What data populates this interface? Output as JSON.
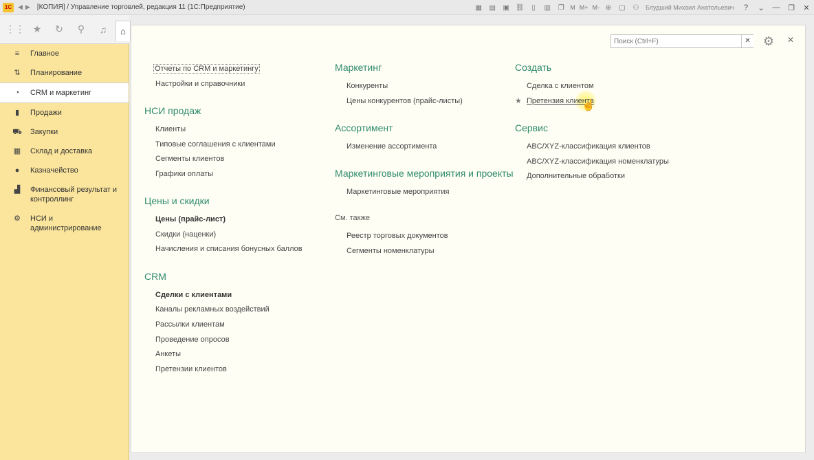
{
  "app": {
    "title": "[КОПИЯ] / Управление торговлей, редакция 11  (1С:Предприятие)",
    "logo": "1С",
    "user": "Блудший Михаил Анатольевич",
    "toolbar_labels": [
      "M",
      "M+",
      "M-"
    ]
  },
  "sidebar": {
    "items": [
      {
        "label": "Главное",
        "icon": "menu-icon",
        "glyph": "≡",
        "active": false
      },
      {
        "label": "Планирование",
        "icon": "planning-icon",
        "glyph": "⇅",
        "active": false
      },
      {
        "label": "CRM и маркетинг",
        "icon": "pie-chart-icon",
        "glyph": "◔",
        "active": true
      },
      {
        "label": "Продажи",
        "icon": "bag-icon",
        "glyph": "▮",
        "active": false
      },
      {
        "label": "Закупки",
        "icon": "cart-icon",
        "glyph": "⛟",
        "active": false
      },
      {
        "label": "Склад и доставка",
        "icon": "warehouse-icon",
        "glyph": "▦",
        "active": false
      },
      {
        "label": "Казначейство",
        "icon": "coin-icon",
        "glyph": "●",
        "active": false
      },
      {
        "label": "Финансовый результат и контроллинг",
        "icon": "bar-chart-icon",
        "glyph": "▟",
        "active": false
      },
      {
        "label": "НСИ и администрирование",
        "icon": "gear-icon",
        "glyph": "⚙",
        "active": false
      }
    ]
  },
  "search": {
    "placeholder": "Поиск (Ctrl+F)"
  },
  "col1": {
    "top_links": [
      "Отчеты по CRM и маркетингу",
      "Настройки и справочники"
    ],
    "nsi_head": "НСИ продаж",
    "nsi_links": [
      "Клиенты",
      "Типовые соглашения с клиентами",
      "Сегменты клиентов",
      "Графики оплаты"
    ],
    "prices_head": "Цены и скидки",
    "prices_links": [
      "Цены (прайс-лист)",
      "Скидки (наценки)",
      "Начисления и списания бонусных баллов"
    ],
    "crm_head": "CRM",
    "crm_links": [
      "Сделки с клиентами",
      "Каналы рекламных воздействий",
      "Рассылки клиентам",
      "Проведение опросов",
      "Анкеты",
      "Претензии клиентов"
    ]
  },
  "col2": {
    "marketing_head": "Маркетинг",
    "marketing_links": [
      "Конкуренты",
      "Цены конкурентов (прайс-листы)"
    ],
    "assort_head": "Ассортимент",
    "assort_links": [
      "Изменение ассортимента"
    ],
    "events_head": "Маркетинговые мероприятия и проекты",
    "events_links": [
      "Маркетинговые мероприятия"
    ],
    "see_also": "См. также",
    "see_also_links": [
      "Реестр торговых документов",
      "Сегменты номенклатуры"
    ]
  },
  "col3": {
    "create_head": "Создать",
    "create_links": [
      "Сделка с клиентом",
      "Претензия клиента"
    ],
    "service_head": "Сервис",
    "service_links": [
      "ABC/XYZ-классификация клиентов",
      "ABC/XYZ-классификация номенклатуры",
      "Дополнительные обработки"
    ]
  }
}
